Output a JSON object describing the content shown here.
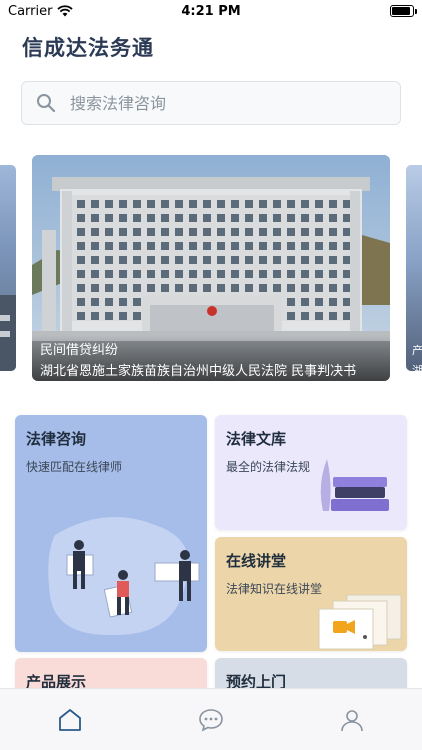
{
  "status_bar": {
    "carrier": "Carrier",
    "time": "4:21 PM",
    "battery_level": 0.9
  },
  "app": {
    "title": "信成达法务通"
  },
  "search": {
    "placeholder": "搜索法律咨询"
  },
  "carousel": {
    "current": {
      "tag": "民间借贷纠纷",
      "title": "湖北省恩施土家族苗族自治州中级人民法院 民事判决书"
    },
    "next_peek": {
      "text": "产\n湖"
    }
  },
  "features": {
    "consult": {
      "title": "法律咨询",
      "subtitle": "快速匹配在线律师"
    },
    "library": {
      "title": "法律文库",
      "subtitle": "最全的法律法规"
    },
    "lecture": {
      "title": "在线讲堂",
      "subtitle": "法律知识在线讲堂"
    },
    "product": {
      "title": "产品展示"
    },
    "visit": {
      "title": "预约上门"
    }
  },
  "tab_bar": {
    "active": "home",
    "icons": [
      "home-icon",
      "chat-icon",
      "profile-icon"
    ],
    "active_color": "#2b5a8a",
    "inactive_color": "#8a94a0"
  },
  "colors": {
    "title": "#2b3a55",
    "consult_bg": "#a7bde9",
    "library_bg": "#ebe8fb",
    "lecture_bg": "#ecd6a9",
    "product_bg": "#f9dcd7",
    "visit_bg": "#d6dde6"
  }
}
